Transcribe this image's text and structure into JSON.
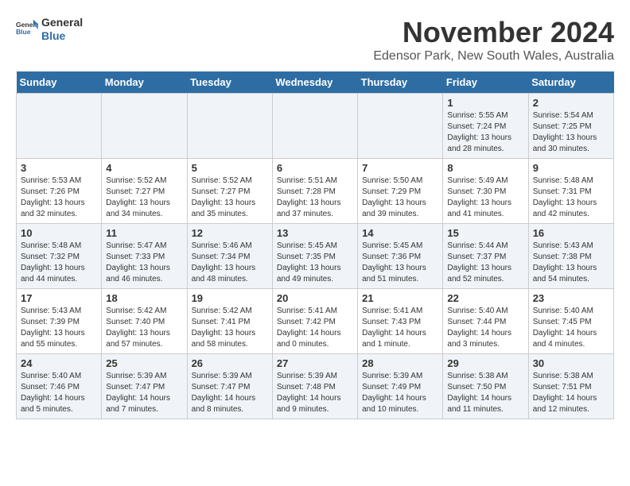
{
  "header": {
    "logo_general": "General",
    "logo_blue": "Blue",
    "month_title": "November 2024",
    "subtitle": "Edensor Park, New South Wales, Australia"
  },
  "weekdays": [
    "Sunday",
    "Monday",
    "Tuesday",
    "Wednesday",
    "Thursday",
    "Friday",
    "Saturday"
  ],
  "weeks": [
    [
      {
        "day": "",
        "info": ""
      },
      {
        "day": "",
        "info": ""
      },
      {
        "day": "",
        "info": ""
      },
      {
        "day": "",
        "info": ""
      },
      {
        "day": "",
        "info": ""
      },
      {
        "day": "1",
        "info": "Sunrise: 5:55 AM\nSunset: 7:24 PM\nDaylight: 13 hours\nand 28 minutes."
      },
      {
        "day": "2",
        "info": "Sunrise: 5:54 AM\nSunset: 7:25 PM\nDaylight: 13 hours\nand 30 minutes."
      }
    ],
    [
      {
        "day": "3",
        "info": "Sunrise: 5:53 AM\nSunset: 7:26 PM\nDaylight: 13 hours\nand 32 minutes."
      },
      {
        "day": "4",
        "info": "Sunrise: 5:52 AM\nSunset: 7:27 PM\nDaylight: 13 hours\nand 34 minutes."
      },
      {
        "day": "5",
        "info": "Sunrise: 5:52 AM\nSunset: 7:27 PM\nDaylight: 13 hours\nand 35 minutes."
      },
      {
        "day": "6",
        "info": "Sunrise: 5:51 AM\nSunset: 7:28 PM\nDaylight: 13 hours\nand 37 minutes."
      },
      {
        "day": "7",
        "info": "Sunrise: 5:50 AM\nSunset: 7:29 PM\nDaylight: 13 hours\nand 39 minutes."
      },
      {
        "day": "8",
        "info": "Sunrise: 5:49 AM\nSunset: 7:30 PM\nDaylight: 13 hours\nand 41 minutes."
      },
      {
        "day": "9",
        "info": "Sunrise: 5:48 AM\nSunset: 7:31 PM\nDaylight: 13 hours\nand 42 minutes."
      }
    ],
    [
      {
        "day": "10",
        "info": "Sunrise: 5:48 AM\nSunset: 7:32 PM\nDaylight: 13 hours\nand 44 minutes."
      },
      {
        "day": "11",
        "info": "Sunrise: 5:47 AM\nSunset: 7:33 PM\nDaylight: 13 hours\nand 46 minutes."
      },
      {
        "day": "12",
        "info": "Sunrise: 5:46 AM\nSunset: 7:34 PM\nDaylight: 13 hours\nand 48 minutes."
      },
      {
        "day": "13",
        "info": "Sunrise: 5:45 AM\nSunset: 7:35 PM\nDaylight: 13 hours\nand 49 minutes."
      },
      {
        "day": "14",
        "info": "Sunrise: 5:45 AM\nSunset: 7:36 PM\nDaylight: 13 hours\nand 51 minutes."
      },
      {
        "day": "15",
        "info": "Sunrise: 5:44 AM\nSunset: 7:37 PM\nDaylight: 13 hours\nand 52 minutes."
      },
      {
        "day": "16",
        "info": "Sunrise: 5:43 AM\nSunset: 7:38 PM\nDaylight: 13 hours\nand 54 minutes."
      }
    ],
    [
      {
        "day": "17",
        "info": "Sunrise: 5:43 AM\nSunset: 7:39 PM\nDaylight: 13 hours\nand 55 minutes."
      },
      {
        "day": "18",
        "info": "Sunrise: 5:42 AM\nSunset: 7:40 PM\nDaylight: 13 hours\nand 57 minutes."
      },
      {
        "day": "19",
        "info": "Sunrise: 5:42 AM\nSunset: 7:41 PM\nDaylight: 13 hours\nand 58 minutes."
      },
      {
        "day": "20",
        "info": "Sunrise: 5:41 AM\nSunset: 7:42 PM\nDaylight: 14 hours\nand 0 minutes."
      },
      {
        "day": "21",
        "info": "Sunrise: 5:41 AM\nSunset: 7:43 PM\nDaylight: 14 hours\nand 1 minute."
      },
      {
        "day": "22",
        "info": "Sunrise: 5:40 AM\nSunset: 7:44 PM\nDaylight: 14 hours\nand 3 minutes."
      },
      {
        "day": "23",
        "info": "Sunrise: 5:40 AM\nSunset: 7:45 PM\nDaylight: 14 hours\nand 4 minutes."
      }
    ],
    [
      {
        "day": "24",
        "info": "Sunrise: 5:40 AM\nSunset: 7:46 PM\nDaylight: 14 hours\nand 5 minutes."
      },
      {
        "day": "25",
        "info": "Sunrise: 5:39 AM\nSunset: 7:47 PM\nDaylight: 14 hours\nand 7 minutes."
      },
      {
        "day": "26",
        "info": "Sunrise: 5:39 AM\nSunset: 7:47 PM\nDaylight: 14 hours\nand 8 minutes."
      },
      {
        "day": "27",
        "info": "Sunrise: 5:39 AM\nSunset: 7:48 PM\nDaylight: 14 hours\nand 9 minutes."
      },
      {
        "day": "28",
        "info": "Sunrise: 5:39 AM\nSunset: 7:49 PM\nDaylight: 14 hours\nand 10 minutes."
      },
      {
        "day": "29",
        "info": "Sunrise: 5:38 AM\nSunset: 7:50 PM\nDaylight: 14 hours\nand 11 minutes."
      },
      {
        "day": "30",
        "info": "Sunrise: 5:38 AM\nSunset: 7:51 PM\nDaylight: 14 hours\nand 12 minutes."
      }
    ]
  ]
}
